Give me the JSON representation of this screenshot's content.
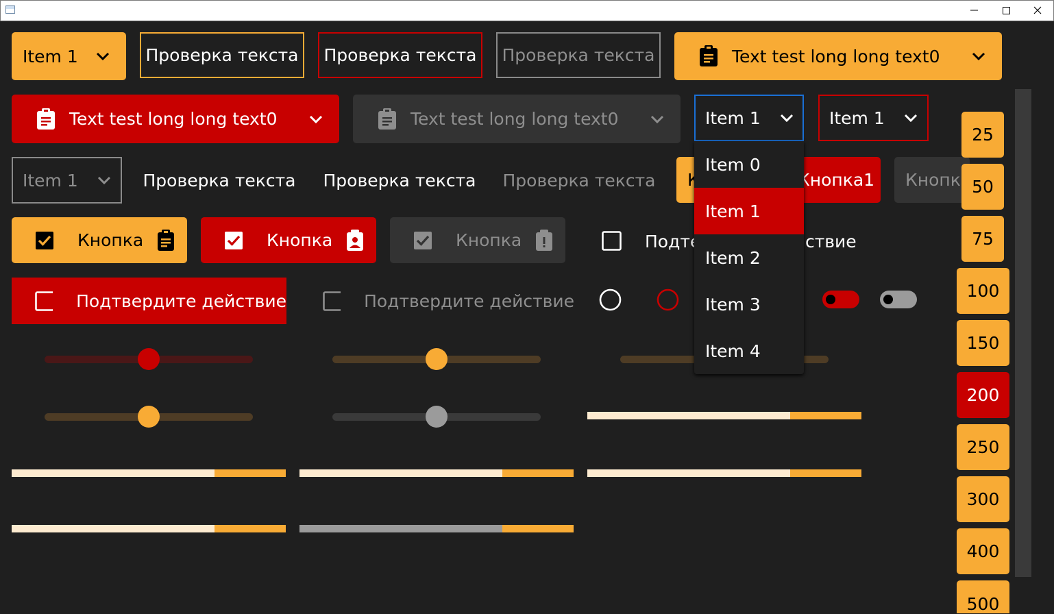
{
  "window": {
    "minimize": "—",
    "maximize": "☐",
    "close": "✕"
  },
  "row1": {
    "combo_orange": "Item 1",
    "outline_orange": "Проверка текста",
    "outline_red": "Проверка текста",
    "outline_gray": "Проверка текста",
    "combo_wide_orange": "Text test long long text0"
  },
  "row2": {
    "combo_wide_red": "Text test long long text0",
    "combo_wide_gray": "Text test long long text0",
    "combo_blue": "Item 1",
    "combo_outline_red": "Item 1"
  },
  "row3": {
    "combo_gray": "Item 1",
    "flat_white_1": "Проверка текста",
    "flat_white_2": "Проверка текста",
    "flat_gray": "Проверка текста",
    "orange_button_partial": "К",
    "red_button": "Кнопка1",
    "gray_button": "Кнопка"
  },
  "row4": {
    "check_orange": "Кнопка",
    "check_red": "Кнопка",
    "check_gray": "Кнопка",
    "checkbox_plain_left": "Подте",
    "checkbox_plain_right": "ствие"
  },
  "row5": {
    "checkbox_red": "Подтвердите действие",
    "checkbox_gray": "Подтвердите действие"
  },
  "dropdown": {
    "items": [
      "Item 0",
      "Item 1",
      "Item 2",
      "Item 3",
      "Item 4"
    ],
    "selected": "Item 1"
  },
  "sliders": [
    {
      "name": "slider-red",
      "value": 0.5
    },
    {
      "name": "slider-orange-1",
      "value": 0.5
    },
    {
      "name": "slider-orange-2",
      "value": 0.5
    },
    {
      "name": "slider-orange-3",
      "value": 0.5
    },
    {
      "name": "slider-gray",
      "value": 0.5
    }
  ],
  "progress": [
    {
      "name": "progress-1",
      "value": 0.74
    },
    {
      "name": "progress-2",
      "value": 0.74
    },
    {
      "name": "progress-3",
      "value": 0.74
    },
    {
      "name": "progress-4",
      "value": 0.74
    },
    {
      "name": "progress-5",
      "value": 0.74
    },
    {
      "name": "progress-6",
      "value": 0.74
    }
  ],
  "side_buttons": [
    "25",
    "50",
    "75",
    "100",
    "150",
    "200",
    "250",
    "300",
    "400",
    "500"
  ],
  "side_selected": "200",
  "colors": {
    "accent": "#f8ab35",
    "danger": "#c80000",
    "focus": "#1a6fd4",
    "background": "#1f1f1f"
  }
}
